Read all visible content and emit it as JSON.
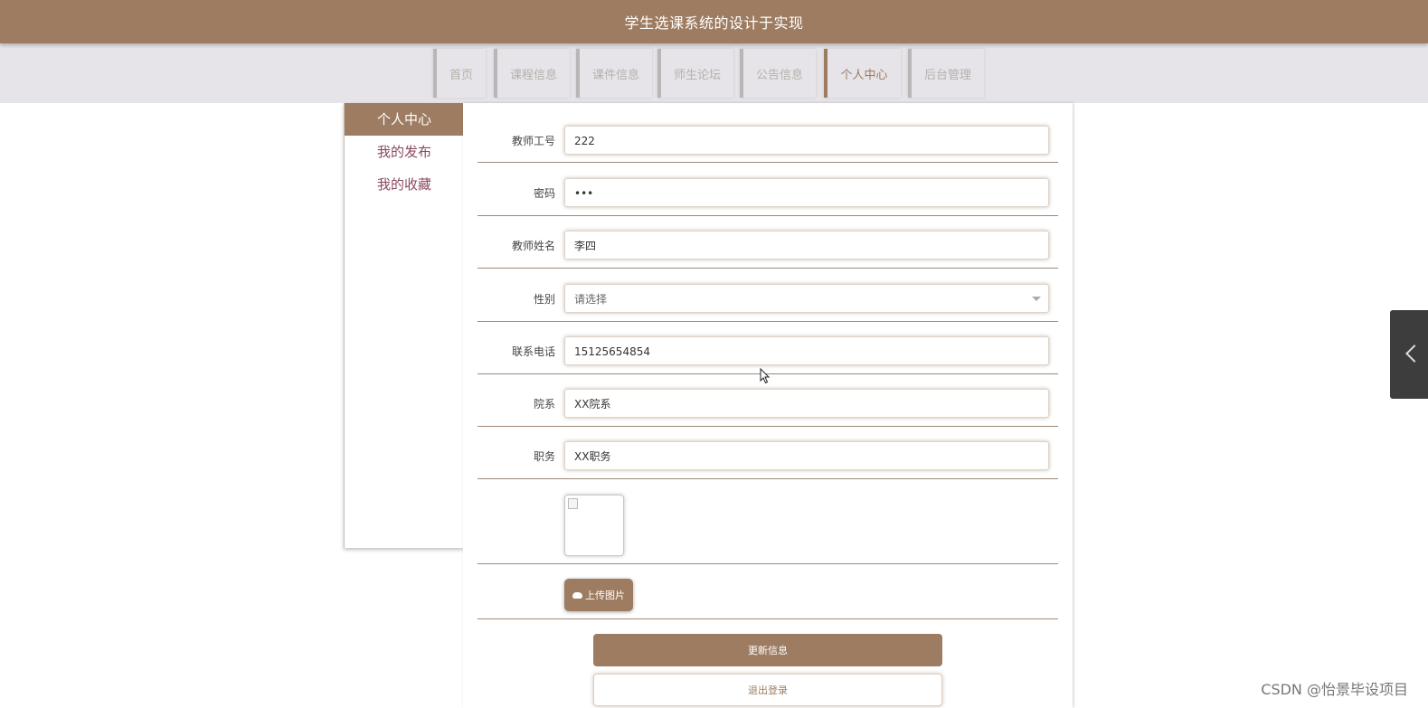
{
  "header": {
    "title": "学生选课系统的设计于实现"
  },
  "nav": {
    "items": [
      {
        "label": "首页"
      },
      {
        "label": "课程信息"
      },
      {
        "label": "课件信息"
      },
      {
        "label": "师生论坛"
      },
      {
        "label": "公告信息"
      },
      {
        "label": "个人中心"
      },
      {
        "label": "后台管理"
      }
    ],
    "active": "个人中心"
  },
  "sidebar": {
    "items": [
      {
        "label": "个人中心"
      },
      {
        "label": "我的发布"
      },
      {
        "label": "我的收藏"
      }
    ]
  },
  "form": {
    "teacher_id": {
      "label": "教师工号",
      "value": "222"
    },
    "password": {
      "label": "密码",
      "value": "•••"
    },
    "teacher_name": {
      "label": "教师姓名",
      "value": "李四"
    },
    "gender": {
      "label": "性别",
      "value": "请选择"
    },
    "phone": {
      "label": "联系电话",
      "value": "15125654854"
    },
    "department": {
      "label": "院系",
      "value": "XX院系"
    },
    "position": {
      "label": "职务",
      "value": "XX职务"
    }
  },
  "buttons": {
    "upload": "上传图片",
    "update": "更新信息",
    "logout": "退出登录"
  },
  "watermark": "CSDN @怡景毕设项目",
  "colors": {
    "accent": "#9e7c61",
    "nav_bg": "#e6e4e8",
    "sidebar_link": "#8a4a5e",
    "drawer": "#3d3d3d"
  }
}
